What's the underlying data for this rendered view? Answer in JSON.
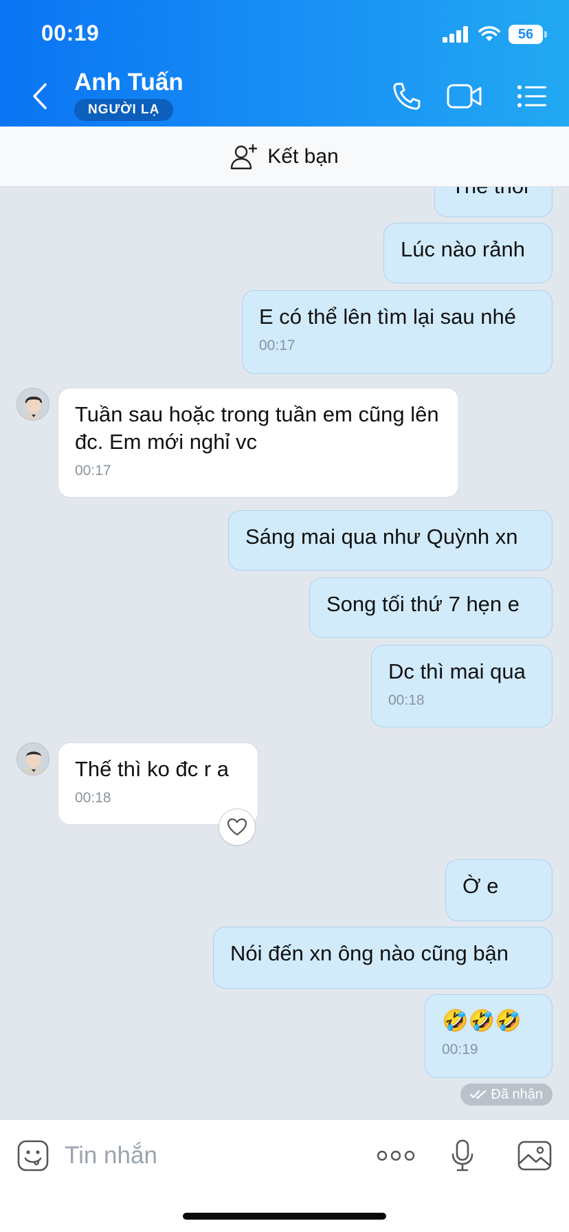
{
  "status_bar": {
    "time": "00:19",
    "battery": "56"
  },
  "header": {
    "contact_name": "Anh Tuấn",
    "badge": "NGƯỜI LẠ",
    "icons": [
      "back-icon",
      "phone-icon",
      "video-call-icon",
      "menu-list-icon"
    ]
  },
  "friend_bar": {
    "label": "Kết bạn",
    "icon": "add-friend-icon"
  },
  "messages": [
    {
      "side": "sent",
      "text": "Thế thôi"
    },
    {
      "side": "sent",
      "text": "Lúc nào rảnh"
    },
    {
      "side": "sent",
      "text": "E có thể lên tìm lại sau nhé",
      "time": "00:17"
    },
    {
      "side": "received",
      "text": "Tuần sau hoặc trong tuần em cũng lên đc. Em mới nghỉ vc",
      "time": "00:17"
    },
    {
      "side": "sent",
      "text": "Sáng mai qua như Quỳnh xn"
    },
    {
      "side": "sent",
      "text": "Song tối thứ 7 hẹn e"
    },
    {
      "side": "sent",
      "text": "Dc thì mai qua",
      "time": "00:18"
    },
    {
      "side": "received",
      "text": "Thế thì ko đc r a",
      "time": "00:18"
    },
    {
      "side": "sent",
      "text": "Ờ e"
    },
    {
      "side": "sent",
      "text": "Nói đến xn ông nào cũng bận"
    },
    {
      "side": "sent",
      "text": "🤣🤣🤣",
      "time": "00:19"
    }
  ],
  "delivery_status": "Đã nhận",
  "input": {
    "placeholder": "Tin nhắn",
    "value": ""
  },
  "input_icons": [
    "sticker-icon",
    "more-options-icon",
    "microphone-icon",
    "image-icon"
  ],
  "colors": {
    "header_start": "#0a74f3",
    "header_end": "#22a9f2",
    "sent_bubble": "#d1ebfb",
    "chat_bg": "#e2e7ee"
  }
}
